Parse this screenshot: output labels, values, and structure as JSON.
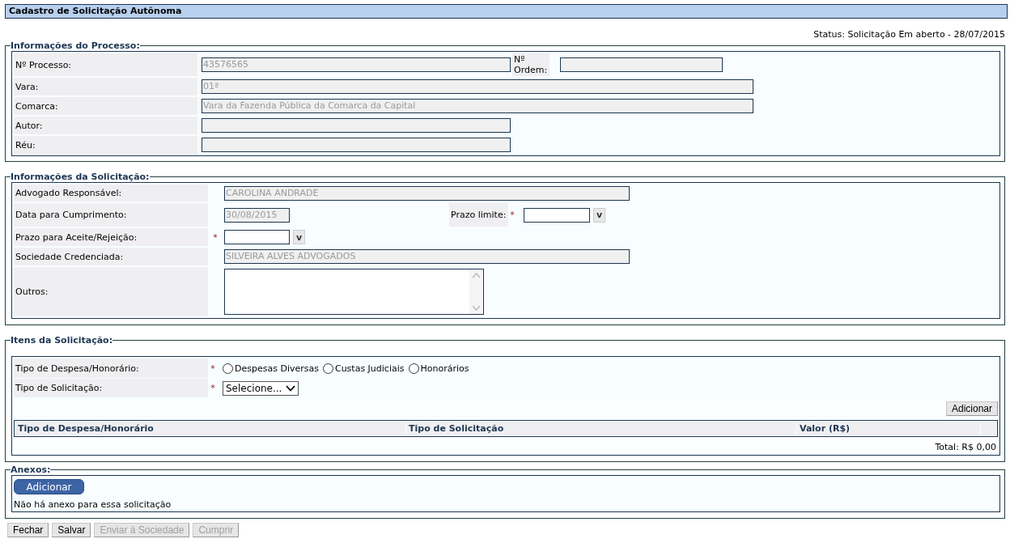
{
  "title": "Cadastro de Solicitação Autônoma",
  "status": "Status: Solicitação Em aberto - 28/07/2015",
  "process": {
    "legend": "Informações do Processo:",
    "numero": {
      "label": "Nº Processo:",
      "value": "43576565",
      "disabled": true
    },
    "ordem": {
      "label": "Nº Ordem:",
      "disabled": true
    },
    "rows": [
      {
        "label": "Vara:",
        "value": "01ª",
        "disabled": true,
        "kind": "long"
      },
      {
        "label": "Comarca:",
        "value": "Vara da Fazenda Pública da Comarca da Capital",
        "disabled": true,
        "kind": "long"
      },
      {
        "label": "Autor:",
        "disabled": true,
        "kind": "short"
      },
      {
        "label": "Réu:",
        "disabled": true,
        "kind": "short"
      }
    ]
  },
  "request": {
    "legend": "Informações da Solicitação:",
    "advogado": {
      "label": "Advogado Responsável:",
      "value": "CAROLINA ANDRADE",
      "disabled": true
    },
    "data": {
      "label": "Data para Cumprimento:",
      "value": "30/08/2015",
      "disabled": true
    },
    "prazo_limite": {
      "label": "Prazo limite:",
      "disabled": false,
      "required_mark": "*",
      "picker": "v"
    },
    "prazo_aceite": {
      "label": "Prazo para Aceite/Rejeição:",
      "disabled": false,
      "required_mark": "*",
      "picker": "v"
    },
    "sociedade": {
      "label": "Sociedade Credenciada:",
      "value": "SILVEIRA ALVES ADVOGADOS",
      "disabled": true
    },
    "outros": {
      "label": "Outros:"
    }
  },
  "items": {
    "legend": "Itens da Solicitação:",
    "tipo_despesa": {
      "label": "Tipo de Despesa/Honorário:",
      "required_mark": "*",
      "options": [
        {
          "label": "Despesas Diversas",
          "selected": false
        },
        {
          "label": "Custas Judiciais",
          "selected": false
        },
        {
          "label": "Honorários",
          "selected": false
        }
      ]
    },
    "tipo_solicitacao": {
      "label": "Tipo de Solicitação:",
      "required_mark": "*",
      "value": "Selecione..."
    },
    "add_button": "Adicionar",
    "table": {
      "columns": [
        "Tipo de Despesa/Honorário",
        "Tipo de Solicitação",
        "Valor (R$)"
      ]
    },
    "total": "Total: R$ 0,00"
  },
  "attachments": {
    "legend": "Anexos:",
    "add_button": "Adicionar",
    "empty_text": "Não há anexo para essa solicitação"
  },
  "buttons": [
    {
      "label": "Fechar",
      "disabled": false
    },
    {
      "label": "Salvar",
      "disabled": false
    },
    {
      "label": "Enviar à Sociedade",
      "disabled": true
    },
    {
      "label": "Cumprir",
      "disabled": true
    }
  ]
}
